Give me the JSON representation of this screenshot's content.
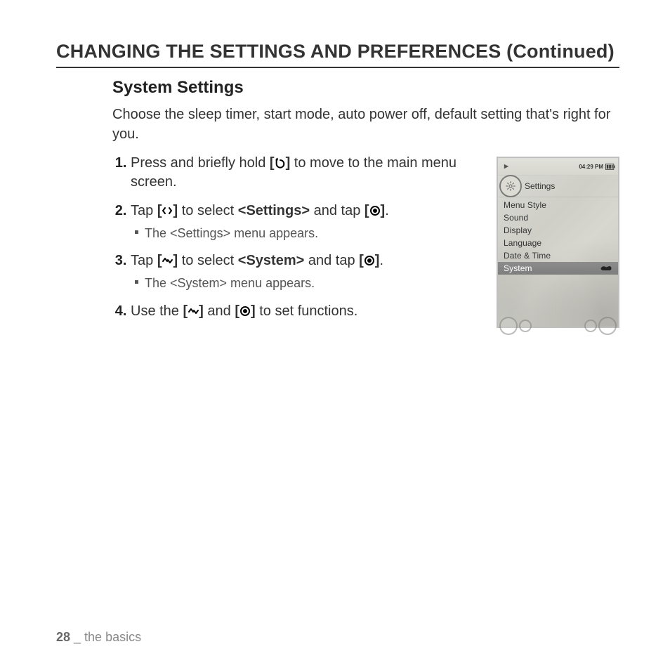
{
  "page": {
    "title": "CHANGING THE SETTINGS AND PREFERENCES (Continued)",
    "subtitle": "System Settings",
    "intro": "Choose the sleep timer, start mode, auto power off, default setting that's right for you.",
    "footer_page": "28",
    "footer_sep": " _ ",
    "footer_section": "the basics"
  },
  "steps": [
    {
      "pre": "Press and briefly hold ",
      "btn_open": "[",
      "btn_close": "]",
      "icon": "back",
      "post": " to move to the main menu screen."
    },
    {
      "pre": "Tap ",
      "btn_open": "[",
      "btn_close": "]",
      "icon": "lr",
      "mid1": " to select ",
      "target": "<Settings>",
      "mid2": " and tap ",
      "btn2_open": "[",
      "icon2": "dot",
      "btn2_close": "]",
      "after": ".",
      "sub": "The <Settings> menu appears."
    },
    {
      "pre": "Tap ",
      "btn_open": "[",
      "btn_close": "]",
      "icon": "ud",
      "mid1": " to select ",
      "target": "<System>",
      "mid2": " and tap ",
      "btn2_open": "[",
      "icon2": "dot",
      "btn2_close": "]",
      "after": ".",
      "sub": "The <System> menu appears."
    },
    {
      "pre": "Use the ",
      "btn_open": "[",
      "btn_close": "]",
      "icon": "ud",
      "mid1": " and ",
      "btn2_open": "[",
      "icon2": "dot",
      "btn2_close": "]",
      "after": " to set functions."
    }
  ],
  "device": {
    "time": "04:29 PM",
    "title": "Settings",
    "menu": [
      "Menu Style",
      "Sound",
      "Display",
      "Language",
      "Date & Time",
      "System"
    ],
    "selected_index": 5
  }
}
